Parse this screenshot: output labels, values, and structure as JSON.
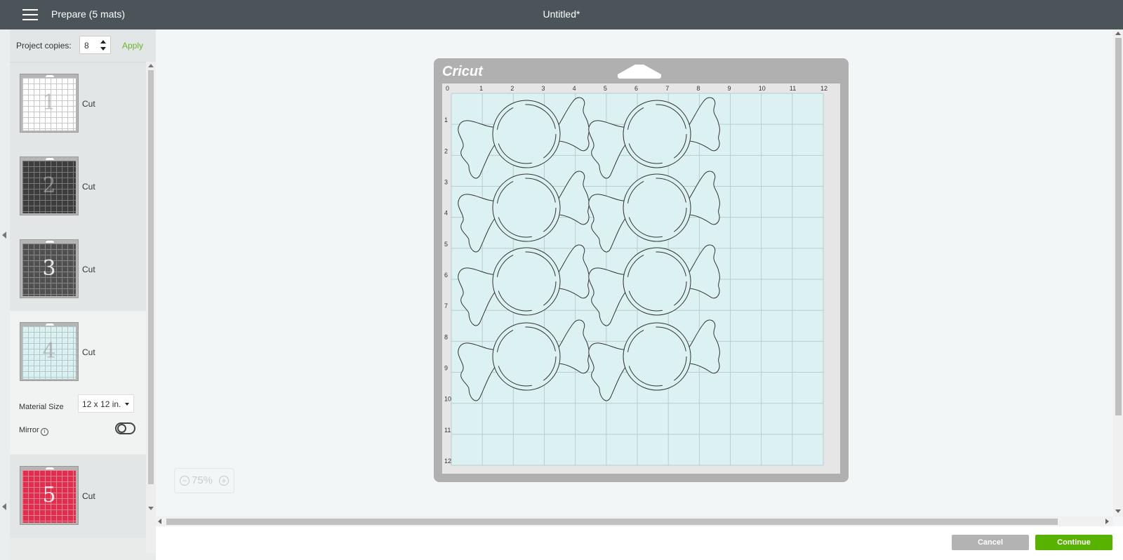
{
  "header": {
    "prepare_title": "Prepare (5 mats)",
    "document_title": "Untitled*"
  },
  "sidebar": {
    "project_copies_label": "Project copies:",
    "project_copies_value": "8",
    "apply_label": "Apply",
    "mats": [
      {
        "number": "1",
        "label": "Cut",
        "color": "#ffffff"
      },
      {
        "number": "2",
        "label": "Cut",
        "color": "#3d3d3d"
      },
      {
        "number": "3",
        "label": "Cut",
        "color": "#505050"
      },
      {
        "number": "4",
        "label": "Cut",
        "color": "#dcf1f2"
      },
      {
        "number": "5",
        "label": "Cut",
        "color": "#e02e4e"
      }
    ],
    "active_mat": 4,
    "material_size_label": "Material Size",
    "material_size_value": "12 x 12 in.",
    "mirror_label": "Mirror",
    "mirror_on": false
  },
  "mat_preview": {
    "logo": "Cricut",
    "ruler_x": [
      "0",
      "1",
      "2",
      "3",
      "4",
      "5",
      "6",
      "7",
      "8",
      "9",
      "10",
      "11",
      "12"
    ],
    "ruler_y": [
      "1",
      "2",
      "3",
      "4",
      "5",
      "6",
      "7",
      "8",
      "9",
      "10",
      "11",
      "12"
    ],
    "shape": "candy",
    "shape_count": 8,
    "shape_fill": "#dcf1f2",
    "mat_color": "#dcf1f2"
  },
  "zoom": {
    "level": "75%",
    "out_icon": "minus-icon",
    "in_icon": "plus-icon"
  },
  "footer": {
    "cancel_label": "Cancel",
    "continue_label": "Continue"
  },
  "colors": {
    "topbar": "#4a5459",
    "accent": "#58b300",
    "apply": "#6ab42d"
  }
}
